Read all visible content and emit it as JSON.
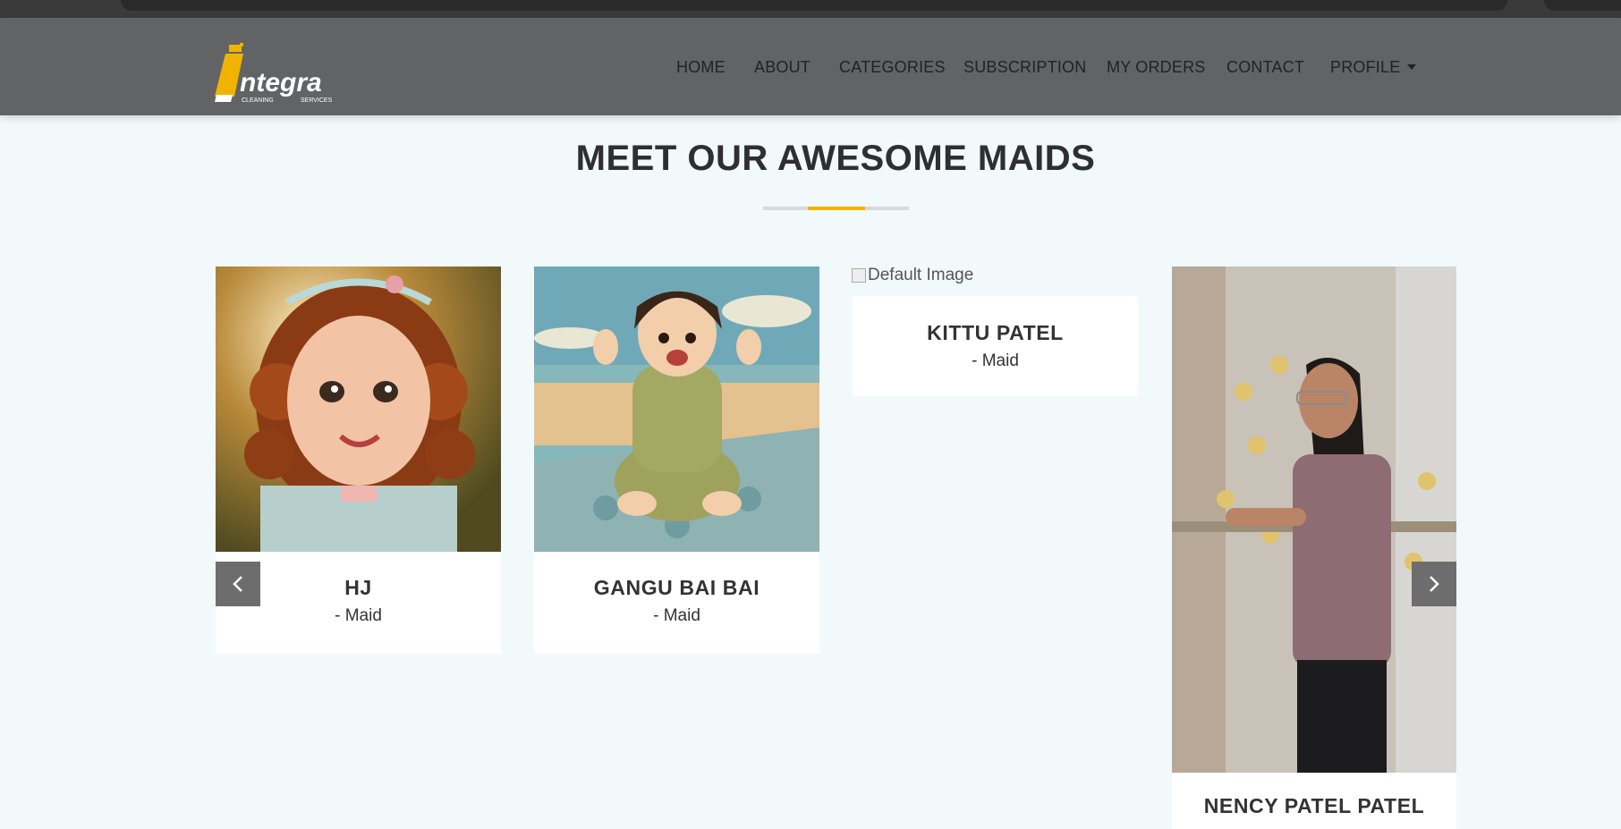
{
  "brand": {
    "logo_text": "ntegra",
    "logo_sub_left": "CLEANING",
    "logo_sub_right": "SERVICES",
    "accent": "#f0b400"
  },
  "nav": {
    "items": [
      {
        "label": "HOME"
      },
      {
        "label": "ABOUT"
      },
      {
        "label": "CATEGORIES"
      },
      {
        "label": "SUBSCRIPTION"
      },
      {
        "label": "MY ORDERS"
      },
      {
        "label": "CONTACT"
      },
      {
        "label": "PROFILE"
      }
    ]
  },
  "section": {
    "title": "MEET OUR AWESOME MAIDS"
  },
  "maids": [
    {
      "name": "HJ",
      "role": "- Maid",
      "image": "photo-girl-curly-hair"
    },
    {
      "name": "GANGU BAI BAI",
      "role": "- Maid",
      "image": "illustration-child-on-blanket"
    },
    {
      "name": "KITTU PATEL",
      "role": "- Maid",
      "image_alt": "Default Image"
    },
    {
      "name": "NENCY PATEL PATEL",
      "role": "",
      "image": "photo-woman-standing"
    }
  ],
  "carousel": {
    "prev_icon": "chevron-left-icon",
    "next_icon": "chevron-right-icon"
  },
  "colors": {
    "navbar": "#626364",
    "page_bg": "#f1f9fb",
    "arrow_bg": "#6d6d6d"
  }
}
